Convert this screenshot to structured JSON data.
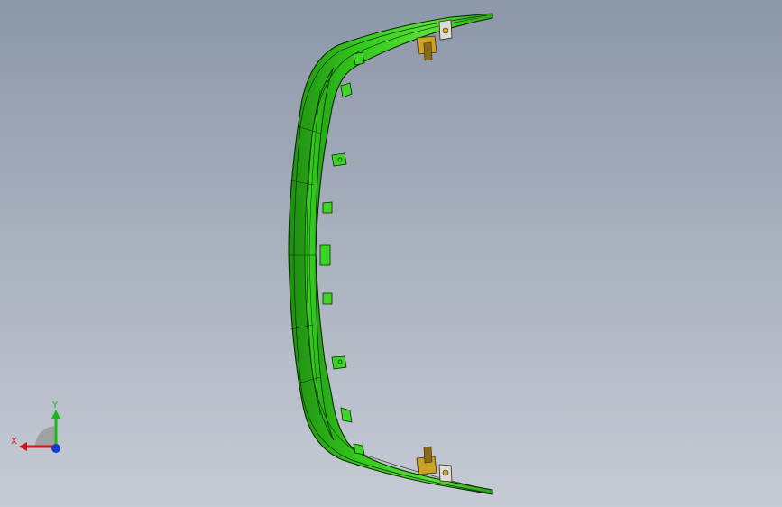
{
  "viewport": {
    "model": {
      "part_color": "#2ecc1a",
      "edge_color": "#0a2a06",
      "bracket_color": "#c9a227"
    },
    "triad": {
      "x_label": "X",
      "y_label": "Y",
      "x_color": "#d01818",
      "y_color": "#18b818",
      "z_color": "#1838d0"
    }
  }
}
